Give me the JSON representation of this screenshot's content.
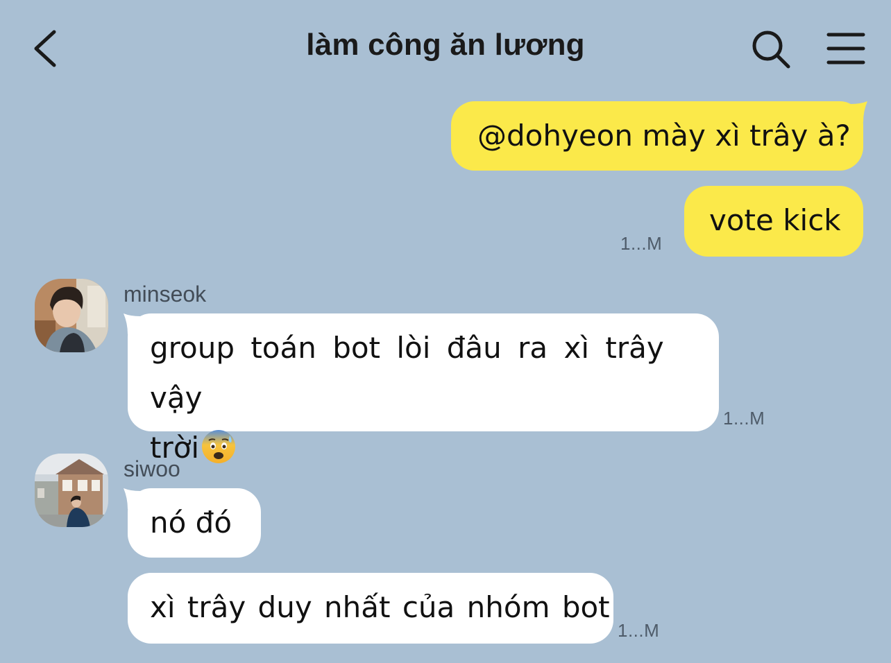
{
  "header": {
    "title": "làm công ăn lương",
    "back_icon": "chevron-left-icon",
    "search_icon": "search-icon",
    "menu_icon": "hamburger-menu-icon"
  },
  "colors": {
    "background": "#a9bfd3",
    "outgoing_bubble": "#fbe94a",
    "incoming_bubble": "#ffffff"
  },
  "messages": [
    {
      "direction": "outgoing",
      "text": "@dohyeon mày xì trây à?"
    },
    {
      "direction": "outgoing",
      "text": "vote kick",
      "timestamp": "1...M"
    },
    {
      "direction": "incoming",
      "sender": "minseok",
      "text_line1": "group toán bot lòi đâu ra xì trây vậy",
      "text_line2": "trời",
      "emoji": "anxious-face-with-sweat-emoji",
      "timestamp": "1...M"
    },
    {
      "direction": "incoming",
      "sender": "siwoo",
      "text": "nó đó"
    },
    {
      "direction": "incoming",
      "text": "xì trây duy nhất của nhóm bot",
      "timestamp": "1...M"
    }
  ]
}
